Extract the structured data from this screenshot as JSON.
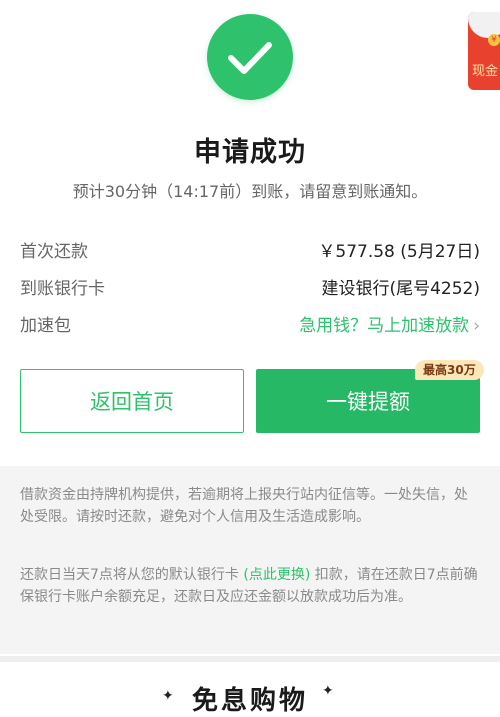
{
  "colors": {
    "accent": "#2ec26d",
    "accent_button": "#26b864",
    "promo_red": "#e8422f",
    "badge_bg": "#fbe7b9"
  },
  "header": {
    "icon": "check-icon",
    "title": "申请成功",
    "subtitle": "预计30分钟（14:17前）到账，请留意到账通知。"
  },
  "promo_float": {
    "label": "现金"
  },
  "details": {
    "repayment": {
      "label": "首次还款",
      "value": "￥577.58 (5月27日)"
    },
    "card": {
      "label": "到账银行卡",
      "value": "建设银行(尾号4252)"
    },
    "speedup": {
      "label": "加速包",
      "value": "急用钱？马上加速放款",
      "chevron": "›"
    }
  },
  "actions": {
    "home_label": "返回首页",
    "raise_label": "一键提额",
    "raise_badge": "最高30万"
  },
  "notice": {
    "para1": "借款资金由持牌机构提供，若逾期将上报央行站内征信等。一处失信，处处受限。请按时还款，避免对个人信用及生活造成影响。",
    "para2_a": "还款日当天7点将从您的默认银行卡 ",
    "para2_link": "(点此更换)",
    "para2_b": " 扣款，请在还款日7点前确保银行卡账户余额充足，还款日及应还金额以放款成功后为准。"
  },
  "bottom": {
    "title": "免息购物",
    "sparkle_left": "✦",
    "sparkle_right": "✦"
  }
}
